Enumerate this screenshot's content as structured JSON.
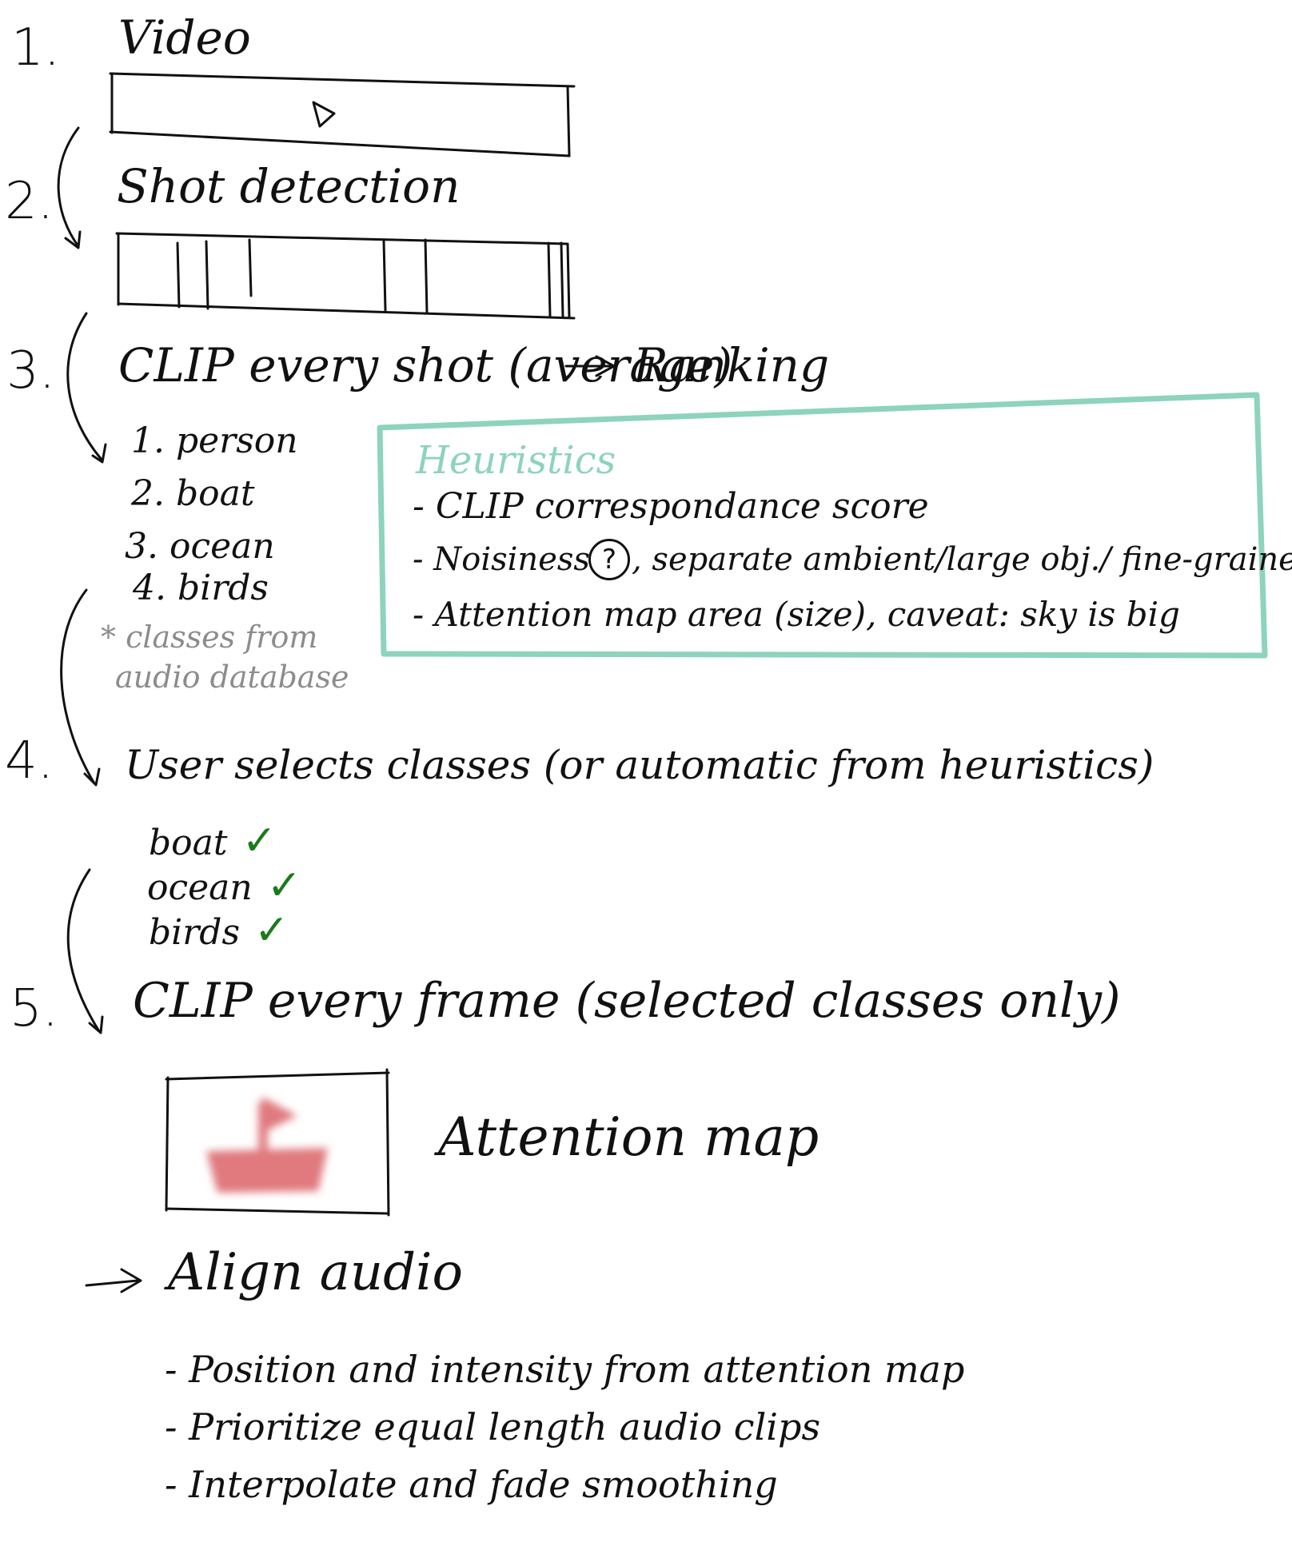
{
  "steps": [
    {
      "num": "1.",
      "title": "Video"
    },
    {
      "num": "2.",
      "title": "Shot detection"
    },
    {
      "num": "3.",
      "title": "CLIP every shot (average)",
      "arrow_label": "Ranking"
    },
    {
      "num": "4.",
      "title": "User selects classes (or automatic from heuristics)"
    },
    {
      "num": "5.",
      "title": "CLIP every frame (selected classes only)"
    }
  ],
  "ranking_list": [
    "1. person",
    "2. boat",
    "3. ocean",
    "4. birds"
  ],
  "classes_note": [
    "* classes from",
    "audio database"
  ],
  "heuristics": {
    "title": "Heuristics",
    "items": [
      "- CLIP correspondance score",
      "- Noisiness",
      ", separate ambient/large obj./ fine-grained ?",
      "- Attention map area (size), caveat: sky is big"
    ],
    "question_mark": "?",
    "border_color": "#8dd3bd"
  },
  "selected_classes": [
    "boat",
    "ocean",
    "birds"
  ],
  "check_mark": "✓",
  "attention_map_label": "Attention map",
  "align_audio": {
    "title": "Align audio",
    "items": [
      "- Position and intensity from attention map",
      "- Prioritize equal length audio clips",
      "- Interpolate and fade smoothing"
    ]
  },
  "colors": {
    "boat": "#e07a7f",
    "check": "#1a7a1a",
    "teal": "#8dd3bd",
    "gray": "#8c8c8c"
  }
}
